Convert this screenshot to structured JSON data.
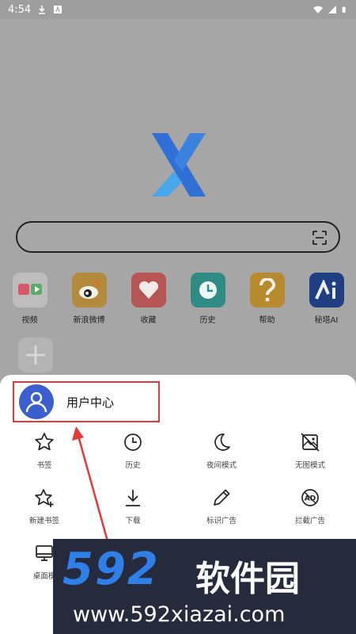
{
  "status_bar": {
    "time": "4:54"
  },
  "home": {
    "search": {
      "value": ""
    },
    "shortcuts": [
      {
        "label": "视频",
        "icon": "video-folder-icon",
        "color": "#e6e6e6"
      },
      {
        "label": "新浪微博",
        "icon": "weibo-icon",
        "color": "#f5a623"
      },
      {
        "label": "收藏",
        "icon": "heart-icon",
        "color": "#ef5350"
      },
      {
        "label": "历史",
        "icon": "clock-icon",
        "color": "#26a69a"
      },
      {
        "label": "帮助",
        "icon": "question-icon",
        "color": "#f9b233"
      },
      {
        "label": "秘塔AI",
        "icon": "metaso-icon",
        "color": "#1e4fb8"
      }
    ]
  },
  "sheet": {
    "user_center": "用户中心",
    "menu": [
      {
        "label": "书签",
        "icon": "star-icon"
      },
      {
        "label": "历史",
        "icon": "clock-icon"
      },
      {
        "label": "夜间模式",
        "icon": "moon-icon"
      },
      {
        "label": "无图模式",
        "icon": "no-image-icon"
      },
      {
        "label": "新建书签",
        "icon": "star-plus-icon"
      },
      {
        "label": "下载",
        "icon": "download-icon"
      },
      {
        "label": "标识广告",
        "icon": "pencil-icon"
      },
      {
        "label": "拦截广告",
        "icon": "ad-block-icon"
      },
      {
        "label": "桌面模",
        "icon": "desktop-icon"
      }
    ]
  },
  "watermark": {
    "brand": "592",
    "name": "软件园",
    "url": "www.592xiazai.com"
  },
  "colors": {
    "accent_red": "#e53935",
    "avatar_blue": "#3b5fcf",
    "logo_blue": "#2f7fe8"
  }
}
